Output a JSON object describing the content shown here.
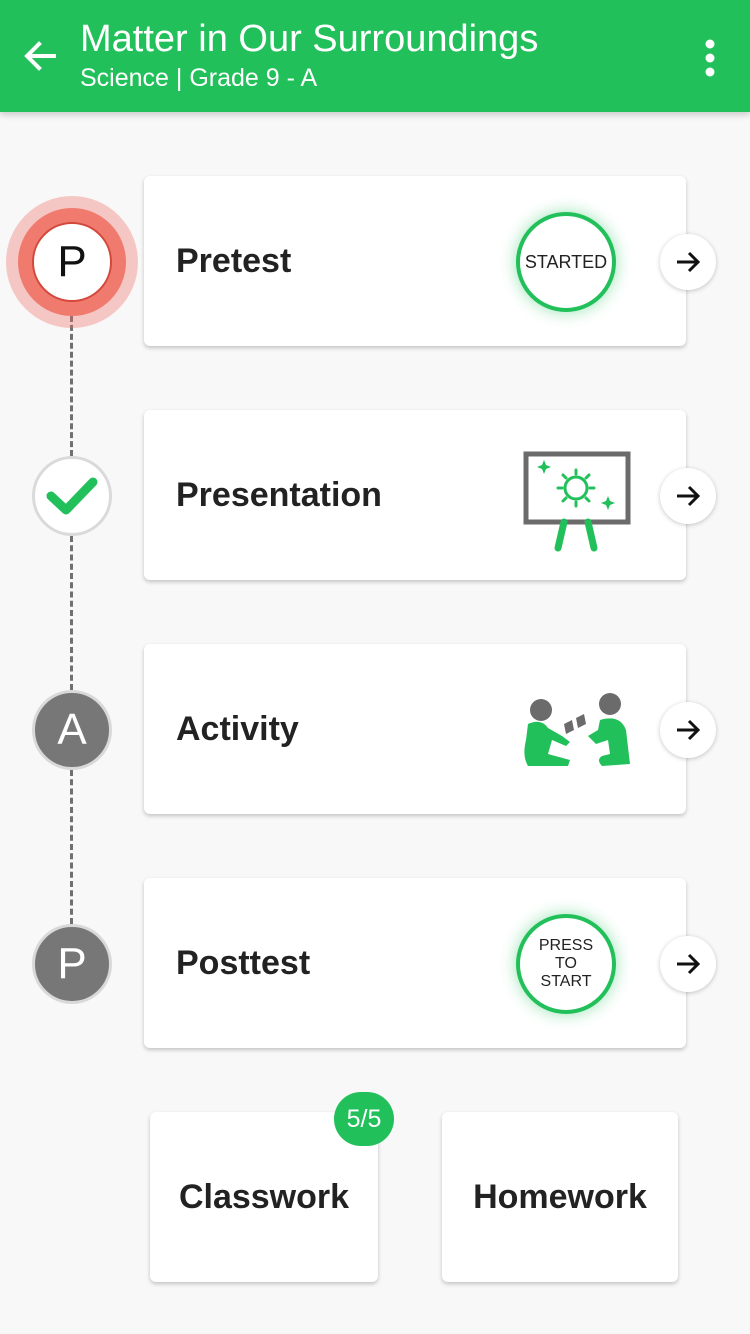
{
  "header": {
    "title": "Matter in Our Surroundings",
    "subtitle": "Science | Grade 9 - A",
    "back_icon": "arrow-left-icon",
    "menu_icon": "more-vertical-icon",
    "background": "#22c05a"
  },
  "steps": [
    {
      "marker": "P",
      "label": "Pretest",
      "badge": "STARTED",
      "state": "current"
    },
    {
      "marker": "check",
      "label": "Presentation",
      "icon": "presentation-board-icon",
      "state": "completed"
    },
    {
      "marker": "A",
      "label": "Activity",
      "icon": "group-activity-icon",
      "state": "locked"
    },
    {
      "marker": "P",
      "label": "Posttest",
      "badge_lines": [
        "PRESS",
        "TO",
        "START"
      ],
      "state": "locked"
    }
  ],
  "bottom": {
    "classwork_label": "Classwork",
    "classwork_count": "5/5",
    "homework_label": "Homework"
  },
  "colors": {
    "accent": "#22c05a",
    "current_marker": "#f07a6e",
    "locked_marker": "#777777"
  }
}
